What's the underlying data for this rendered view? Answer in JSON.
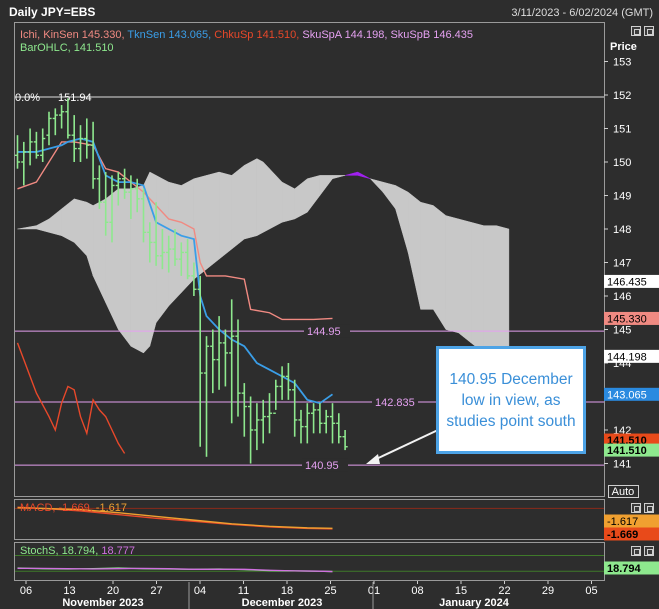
{
  "header": {
    "title": "Daily JPY=EBS",
    "date_range": "3/11/2023 - 6/02/2024 (GMT)"
  },
  "price_axis_label": "Price",
  "auto_label": "Auto",
  "legend": {
    "line1": [
      {
        "text": "Ichi, KinSen 145.330,",
        "color": "#f08a82"
      },
      {
        "text": "TknSen 143.065,",
        "color": "#3a9ee8"
      },
      {
        "text": "ChkuSp 141.510,",
        "color": "#e8482a"
      },
      {
        "text": "SkuSpA 144.198,",
        "color": "#e4a0f0"
      },
      {
        "text": "SkuSpB 146.435",
        "color": "#e4a0f0"
      }
    ],
    "line2": [
      {
        "text": "BarOHLC, 141.510",
        "color": "#8ee88e"
      }
    ]
  },
  "annotation": {
    "text": "140.95 December low in view, as studies point south"
  },
  "macd_legend": [
    {
      "text": "MACD, -1.669,",
      "color": "#e8482a"
    },
    {
      "text": "-1.617",
      "color": "#f0a030"
    }
  ],
  "stoch_legend": [
    {
      "text": "StochS, 18.794,",
      "color": "#8ee88e"
    },
    {
      "text": "18.777",
      "color": "#d070e0"
    }
  ],
  "colors": {
    "background": "#2d2d2d",
    "bars": "#8ee88e",
    "kijun": "#f08a82",
    "tenkan": "#3a9ee8",
    "chikou": "#e8482a",
    "cloud_bull": "#c8c8c8",
    "cloud_bear": "#a020f0",
    "fib": "#e4a0f0"
  },
  "chart_data": [
    {
      "type": "ohlc",
      "ylim": [
        140.5,
        153.8
      ],
      "y_ticks": [
        141,
        142,
        143,
        144,
        145,
        146,
        147,
        148,
        149,
        150,
        151,
        152,
        153
      ],
      "x_ticks": [
        "06",
        "13",
        "20",
        "27",
        "04",
        "11",
        "18",
        "25",
        "01",
        "08",
        "15",
        "22",
        "29",
        "05"
      ],
      "month_labels": [
        "November 2023",
        "December 2023",
        "January 2024"
      ],
      "level_lines": [
        {
          "label": "0.0%",
          "value": 151.94,
          "value_label": "151.94"
        },
        {
          "label": "",
          "value": 144.95,
          "value_label": "144.95"
        },
        {
          "label": "",
          "value": 142.835,
          "value_label": "142.835"
        },
        {
          "label": "",
          "value": 140.95,
          "value_label": "140.95"
        }
      ],
      "price_tags": [
        {
          "value": 146.435,
          "text": "146.435",
          "bg": "#ffffff",
          "fg": "#000000"
        },
        {
          "value": 145.33,
          "text": "145.330",
          "bg": "#f08a82",
          "fg": "#000000"
        },
        {
          "value": 144.198,
          "text": "144.198",
          "bg": "#ffffff",
          "fg": "#000000"
        },
        {
          "value": 143.065,
          "text": "143.065",
          "bg": "#2a8ae0",
          "fg": "#ffffff"
        },
        {
          "value": 141.7,
          "text": "141.510",
          "bg": "#e84a1a",
          "fg": "#000000"
        },
        {
          "value": 141.4,
          "text": "141.510",
          "bg": "#8ee88e",
          "fg": "#000000"
        }
      ],
      "bars": [
        [
          150.2,
          150.8,
          149.8,
          150.0
        ],
        [
          150.0,
          150.6,
          149.3,
          150.3
        ],
        [
          150.3,
          151.0,
          149.9,
          150.6
        ],
        [
          150.6,
          150.9,
          150.1,
          150.2
        ],
        [
          150.2,
          151.0,
          150.0,
          150.7
        ],
        [
          150.8,
          151.5,
          150.5,
          151.3
        ],
        [
          151.3,
          151.6,
          150.8,
          151.4
        ],
        [
          151.4,
          151.7,
          151.0,
          151.5
        ],
        [
          151.5,
          151.9,
          150.7,
          150.8
        ],
        [
          150.8,
          151.4,
          150.0,
          150.4
        ],
        [
          150.4,
          151.1,
          150.0,
          150.7
        ],
        [
          150.7,
          151.3,
          150.1,
          150.5
        ],
        [
          150.5,
          151.2,
          149.2,
          149.5
        ],
        [
          149.5,
          149.9,
          148.6,
          148.8
        ],
        [
          148.8,
          149.7,
          147.8,
          148.2
        ],
        [
          148.2,
          149.6,
          147.6,
          149.3
        ],
        [
          149.3,
          149.7,
          148.7,
          149.5
        ],
        [
          149.5,
          149.8,
          148.9,
          149.1
        ],
        [
          149.1,
          149.6,
          148.3,
          149.2
        ],
        [
          149.2,
          149.5,
          148.5,
          148.9
        ],
        [
          148.9,
          149.2,
          147.6,
          147.9
        ],
        [
          147.9,
          148.2,
          147.0,
          147.6
        ],
        [
          147.6,
          148.8,
          146.9,
          147.2
        ],
        [
          147.2,
          148.0,
          146.8,
          147.3
        ],
        [
          147.3,
          147.8,
          146.7,
          147.4
        ],
        [
          147.4,
          148.0,
          146.9,
          147.1
        ],
        [
          147.1,
          147.6,
          146.6,
          147.3
        ],
        [
          147.3,
          147.7,
          146.5,
          146.6
        ],
        [
          146.6,
          147.0,
          146.0,
          146.2
        ],
        [
          146.2,
          146.6,
          141.5,
          143.7
        ],
        [
          143.7,
          144.8,
          141.2,
          144.5
        ],
        [
          144.5,
          145.0,
          143.1,
          144.1
        ],
        [
          144.1,
          145.4,
          143.2,
          144.6
        ],
        [
          144.6,
          145.0,
          143.3,
          144.3
        ],
        [
          144.3,
          145.9,
          142.2,
          144.8
        ],
        [
          144.8,
          145.3,
          142.4,
          143.1
        ],
        [
          143.1,
          143.4,
          141.8,
          142.7
        ],
        [
          142.7,
          143.0,
          141.0,
          142.0
        ],
        [
          142.0,
          142.8,
          141.4,
          142.3
        ],
        [
          142.3,
          142.9,
          141.6,
          142.4
        ],
        [
          142.4,
          143.1,
          141.9,
          142.5
        ],
        [
          142.5,
          143.5,
          142.6,
          143.3
        ],
        [
          143.3,
          143.9,
          142.9,
          143.6
        ],
        [
          143.6,
          144.0,
          142.9,
          143.2
        ],
        [
          143.2,
          143.5,
          141.8,
          142.3
        ],
        [
          142.3,
          142.6,
          141.6,
          142.1
        ],
        [
          142.1,
          142.8,
          141.6,
          142.5
        ],
        [
          142.5,
          142.8,
          141.9,
          142.6
        ],
        [
          142.6,
          142.8,
          141.9,
          142.2
        ],
        [
          142.2,
          142.6,
          141.9,
          142.4
        ],
        [
          142.4,
          142.8,
          141.6,
          142.2
        ],
        [
          142.2,
          142.5,
          141.6,
          141.8
        ],
        [
          141.8,
          142.0,
          141.4,
          141.5
        ]
      ],
      "kijun": [
        [
          0,
          149.2
        ],
        [
          3,
          149.4
        ],
        [
          5,
          150.0
        ],
        [
          7,
          150.6
        ],
        [
          9,
          150.6
        ],
        [
          12,
          150.5
        ],
        [
          14,
          149.8
        ],
        [
          16,
          149.7
        ],
        [
          18,
          149.4
        ],
        [
          20,
          149.1
        ],
        [
          22,
          148.7
        ],
        [
          24,
          148.3
        ],
        [
          26,
          148.2
        ],
        [
          28,
          148.0
        ],
        [
          29,
          147.0
        ],
        [
          30,
          146.6
        ],
        [
          33,
          146.6
        ],
        [
          36,
          146.5
        ],
        [
          37,
          145.6
        ],
        [
          40,
          145.5
        ],
        [
          42,
          145.3
        ],
        [
          45,
          145.3
        ],
        [
          47,
          145.3
        ],
        [
          50,
          145.33
        ]
      ],
      "tenkan": [
        [
          0,
          150.3
        ],
        [
          3,
          150.3
        ],
        [
          5,
          150.4
        ],
        [
          7,
          150.5
        ],
        [
          8,
          150.6
        ],
        [
          10,
          150.7
        ],
        [
          12,
          150.6
        ],
        [
          14,
          149.6
        ],
        [
          16,
          149.4
        ],
        [
          18,
          149.4
        ],
        [
          20,
          149.3
        ],
        [
          22,
          148.2
        ],
        [
          24,
          148.0
        ],
        [
          26,
          147.8
        ],
        [
          28,
          147.7
        ],
        [
          29,
          146.0
        ],
        [
          30,
          145.4
        ],
        [
          32,
          145.0
        ],
        [
          34,
          144.7
        ],
        [
          36,
          144.5
        ],
        [
          38,
          144.0
        ],
        [
          40,
          143.8
        ],
        [
          42,
          143.6
        ],
        [
          44,
          143.4
        ],
        [
          46,
          142.9
        ],
        [
          48,
          142.8
        ],
        [
          50,
          143.065
        ]
      ],
      "chikou": [
        [
          0,
          144.6
        ],
        [
          2,
          143.6
        ],
        [
          3,
          143.1
        ],
        [
          5,
          142.4
        ],
        [
          6,
          142.0
        ],
        [
          7,
          142.8
        ],
        [
          8,
          143.3
        ],
        [
          9,
          143.2
        ],
        [
          10,
          142.4
        ],
        [
          11,
          141.9
        ],
        [
          12,
          142.9
        ],
        [
          13,
          142.6
        ],
        [
          14,
          142.4
        ],
        [
          15,
          142.0
        ],
        [
          16,
          141.6
        ],
        [
          17,
          141.3
        ]
      ],
      "cloud_x": [
        0,
        3,
        5,
        7,
        9,
        11,
        12,
        14,
        16,
        18,
        20,
        21,
        22,
        24,
        26,
        28,
        30,
        32,
        34,
        36,
        38,
        39,
        40,
        42,
        44,
        46,
        48,
        50,
        52,
        54,
        56,
        58,
        60,
        62,
        64,
        66,
        68,
        70,
        72,
        74,
        76,
        78
      ],
      "span_a": [
        148.0,
        148.1,
        148.3,
        148.6,
        148.9,
        148.8,
        148.7,
        148.9,
        149.2,
        149.2,
        149.3,
        149.7,
        149.6,
        149.4,
        149.3,
        149.5,
        149.6,
        149.7,
        149.6,
        149.9,
        150.1,
        150.0,
        149.8,
        149.4,
        149.2,
        149.5,
        149.6,
        149.6,
        149.6,
        149.6,
        149.5,
        149.4,
        149.3,
        149.1,
        148.8,
        148.7,
        148.4,
        148.3,
        148.2,
        148.1,
        148.1,
        148.0
      ],
      "span_b": [
        148.0,
        148.0,
        147.9,
        147.8,
        147.6,
        147.2,
        146.6,
        145.8,
        145.0,
        144.5,
        144.3,
        144.5,
        145.2,
        145.7,
        146.1,
        146.5,
        146.8,
        147.1,
        147.4,
        147.7,
        147.8,
        147.9,
        148.0,
        148.2,
        148.3,
        148.5,
        149.0,
        149.5,
        149.6,
        149.7,
        149.5,
        149.1,
        148.6,
        147.3,
        145.6,
        145.6,
        145.0,
        144.9,
        144.6,
        144.3,
        144.0,
        143.6
      ]
    },
    {
      "type": "line",
      "name_text": "MACD",
      "ylim": [
        -2.4,
        0.6
      ],
      "series": [
        {
          "name": "MACD",
          "color": "#e8482a",
          "values": [
            [
              0,
              0.1
            ],
            [
              4,
              0.0
            ],
            [
              10,
              -0.2
            ],
            [
              16,
              -0.5
            ],
            [
              22,
              -0.8
            ],
            [
              28,
              -1.05
            ],
            [
              34,
              -1.3
            ],
            [
              40,
              -1.5
            ],
            [
              46,
              -1.62
            ],
            [
              50,
              -1.669
            ]
          ]
        },
        {
          "name": "Signal",
          "color": "#f0a030",
          "values": [
            [
              0,
              0.05
            ],
            [
              4,
              0.0
            ],
            [
              10,
              -0.1
            ],
            [
              16,
              -0.35
            ],
            [
              22,
              -0.65
            ],
            [
              28,
              -0.95
            ],
            [
              34,
              -1.25
            ],
            [
              40,
              -1.45
            ],
            [
              46,
              -1.58
            ],
            [
              50,
              -1.617
            ]
          ]
        }
      ],
      "tags": [
        {
          "text": "-1.617",
          "bg": "#f0a030",
          "fg": "#000000"
        },
        {
          "text": "-1.669",
          "bg": "#e84a1a",
          "fg": "#000000"
        }
      ]
    },
    {
      "type": "line",
      "name_text": "StochS",
      "ylim": [
        0,
        100
      ],
      "series": [
        {
          "name": "%K",
          "color": "#8ee88e",
          "values": [
            [
              0,
              30
            ],
            [
              4,
              28
            ],
            [
              8,
              27
            ],
            [
              12,
              28
            ],
            [
              16,
              30
            ],
            [
              20,
              28
            ],
            [
              24,
              27
            ],
            [
              28,
              26
            ],
            [
              32,
              27
            ],
            [
              36,
              25
            ],
            [
              40,
              22
            ],
            [
              44,
              21
            ],
            [
              48,
              20
            ],
            [
              50,
              18.794
            ]
          ]
        },
        {
          "name": "%D",
          "color": "#d070e0",
          "values": [
            [
              0,
              29
            ],
            [
              4,
              29
            ],
            [
              8,
              28
            ],
            [
              12,
              27
            ],
            [
              16,
              28
            ],
            [
              20,
              29
            ],
            [
              24,
              28
            ],
            [
              28,
              26
            ],
            [
              32,
              26
            ],
            [
              36,
              26
            ],
            [
              40,
              23
            ],
            [
              44,
              21
            ],
            [
              48,
              20
            ],
            [
              50,
              18.777
            ]
          ]
        }
      ],
      "tags": [
        {
          "text": "18.794",
          "bg": "#8ee88e",
          "fg": "#000000"
        }
      ]
    }
  ]
}
